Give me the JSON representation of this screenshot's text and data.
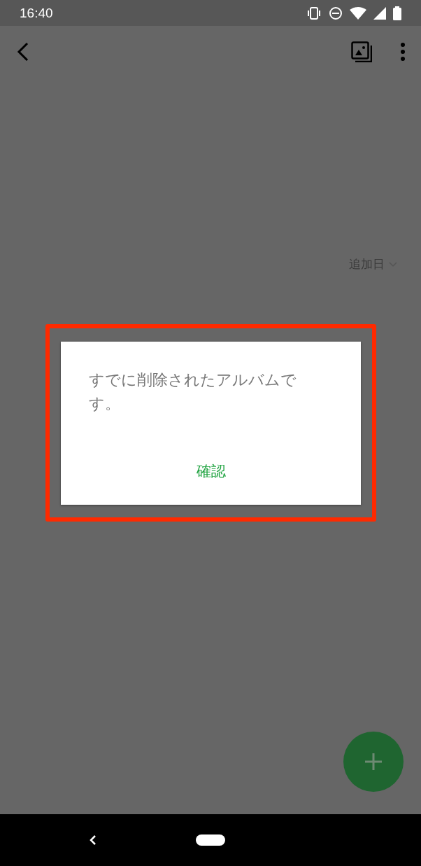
{
  "status_bar": {
    "time": "16:40"
  },
  "sort": {
    "label": "追加日"
  },
  "dialog": {
    "message": "すでに削除されたアルバムです。",
    "button": "確認"
  }
}
